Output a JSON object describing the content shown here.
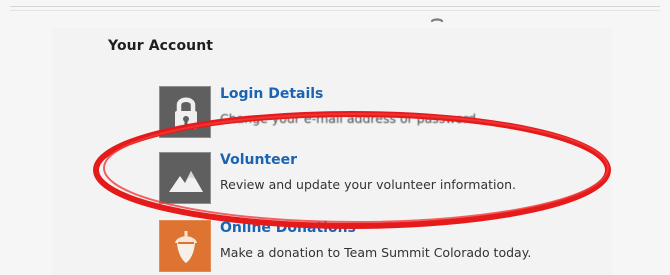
{
  "section": {
    "title": "Your Account"
  },
  "items": [
    {
      "title": "Login Details",
      "desc": "Change your e-mail address or password."
    },
    {
      "title": "Volunteer",
      "desc": "Review and update your volunteer information."
    },
    {
      "title": "Online Donations",
      "desc": "Make a donation to Team Summit Colorado today."
    }
  ],
  "icons": {
    "login": "lock-icon",
    "volunteer": "mountain-icon",
    "donation": "acorn-icon",
    "cursor": "cursor-icon"
  },
  "colors": {
    "link": "#1b63b3",
    "highlight": "#e51b1b",
    "icon_gray": "#5f5f5f",
    "icon_orange": "#de7431"
  }
}
